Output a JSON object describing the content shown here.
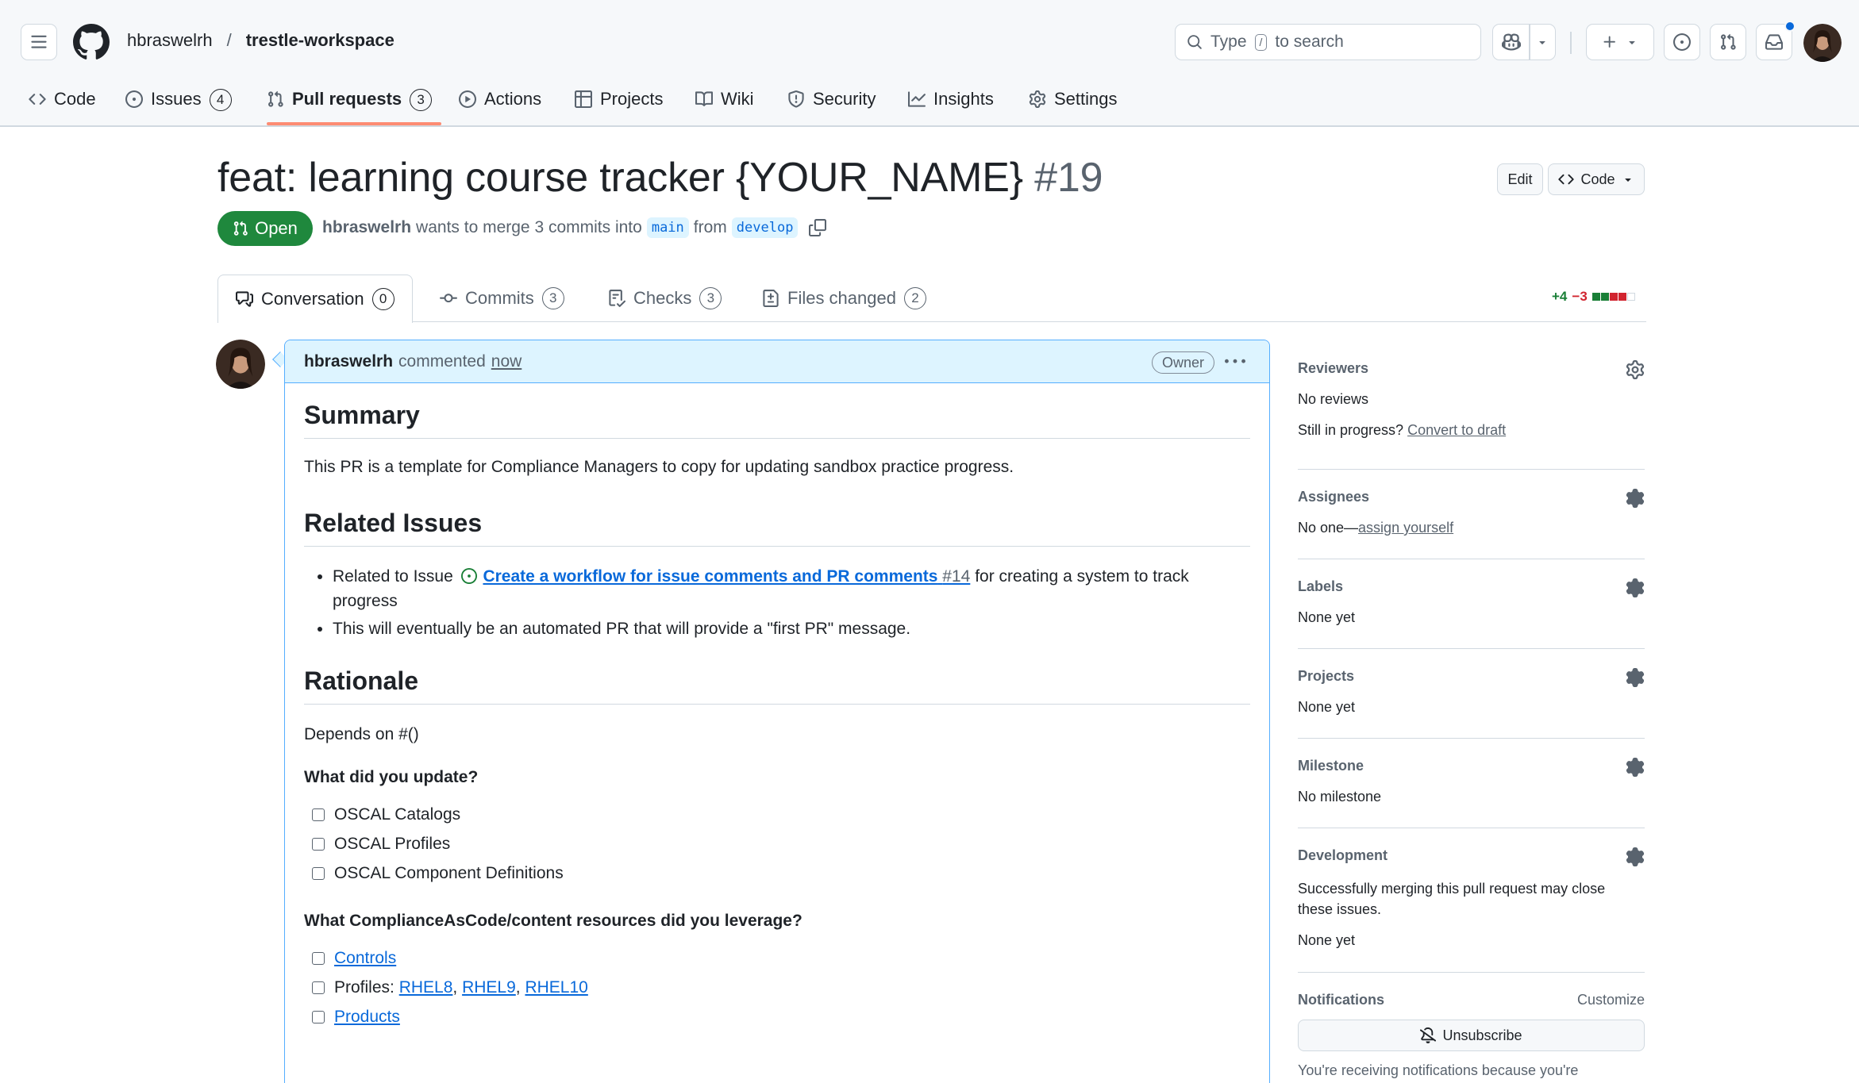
{
  "repo": {
    "owner": "hbraswelrh",
    "separator": "/",
    "name": "trestle-workspace"
  },
  "search": {
    "prefix": "Type",
    "key": "/",
    "suffix": "to search"
  },
  "nav": {
    "code": "Code",
    "issues": "Issues",
    "issues_count": "4",
    "pulls": "Pull requests",
    "pulls_count": "3",
    "actions": "Actions",
    "projects": "Projects",
    "wiki": "Wiki",
    "security": "Security",
    "insights": "Insights",
    "settings": "Settings"
  },
  "pr": {
    "title": "feat: learning course tracker {YOUR_NAME}",
    "number": "#19",
    "edit_label": "Edit",
    "code_label": "Code",
    "state": "Open",
    "author": "hbraswelrh",
    "merge_text": "wants to merge 3 commits into",
    "base": "main",
    "from": "from",
    "head": "develop"
  },
  "tabs": {
    "conversation": "Conversation",
    "conversation_count": "0",
    "commits": "Commits",
    "commits_count": "3",
    "checks": "Checks",
    "checks_count": "3",
    "files": "Files changed",
    "files_count": "2"
  },
  "diffstat": {
    "additions": "+4",
    "deletions": "−3",
    "colors": [
      "#1a7f37",
      "#1a7f37",
      "#d1242f",
      "#d1242f",
      "#ffffff"
    ]
  },
  "comment": {
    "author": "hbraswelrh",
    "action": "commented",
    "when": "now",
    "role": "Owner",
    "summary_heading": "Summary",
    "summary_text": "This PR is a template for Compliance Managers to copy for updating sandbox practice progress.",
    "related_heading": "Related Issues",
    "related_item1_prefix": "Related to Issue",
    "related_item1_link": "Create a workflow for issue comments and PR comments",
    "related_item1_num": "#14",
    "related_item1_suffix": "for creating a system to track progress",
    "related_item2": "This will eventually be an automated PR that will provide a \"first PR\" message.",
    "rationale_heading": "Rationale",
    "depends": "Depends on #()",
    "update_q": "What did you update?",
    "updates": [
      "OSCAL Catalogs",
      "OSCAL Profiles",
      "OSCAL Component Definitions"
    ],
    "resources_q": "What ComplianceAsCode/content resources did you leverage?",
    "res_controls": "Controls",
    "res_profiles_prefix": "Profiles:",
    "res_rhel8": "RHEL8",
    "res_rhel9": "RHEL9",
    "res_rhel10": "RHEL10",
    "res_products": "Products"
  },
  "sidebar": {
    "reviewers": {
      "title": "Reviewers",
      "value": "No reviews",
      "draft_prefix": "Still in progress?",
      "draft_link": "Convert to draft"
    },
    "assignees": {
      "title": "Assignees",
      "value_prefix": "No one—",
      "value_link": "assign yourself"
    },
    "labels": {
      "title": "Labels",
      "value": "None yet"
    },
    "projects": {
      "title": "Projects",
      "value": "None yet"
    },
    "milestone": {
      "title": "Milestone",
      "value": "No milestone"
    },
    "development": {
      "title": "Development",
      "desc": "Successfully merging this pull request may close these issues.",
      "value": "None yet"
    },
    "notifications": {
      "title": "Notifications",
      "customize": "Customize",
      "button": "Unsubscribe",
      "footer": "You're receiving notifications because you're"
    }
  }
}
